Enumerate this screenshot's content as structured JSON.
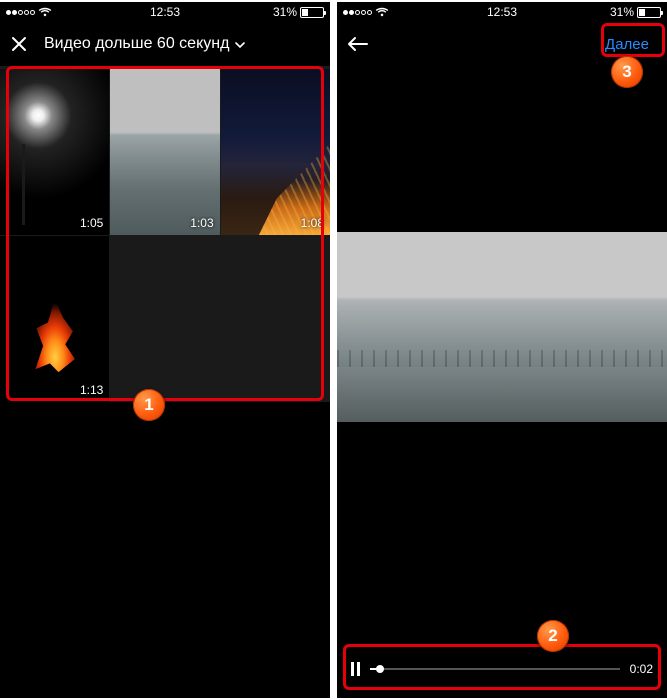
{
  "status": {
    "time": "12:53",
    "carrier": "OOOO",
    "battery_pct": "31%"
  },
  "left": {
    "title": "Видео дольше 60 секунд",
    "videos": [
      {
        "duration": "1:05"
      },
      {
        "duration": "1:03"
      },
      {
        "duration": "1:08"
      },
      {
        "duration": "1:13"
      }
    ]
  },
  "right": {
    "next_label": "Далее",
    "playback_time": "0:02"
  },
  "callouts": {
    "one": "1",
    "two": "2",
    "three": "3"
  }
}
